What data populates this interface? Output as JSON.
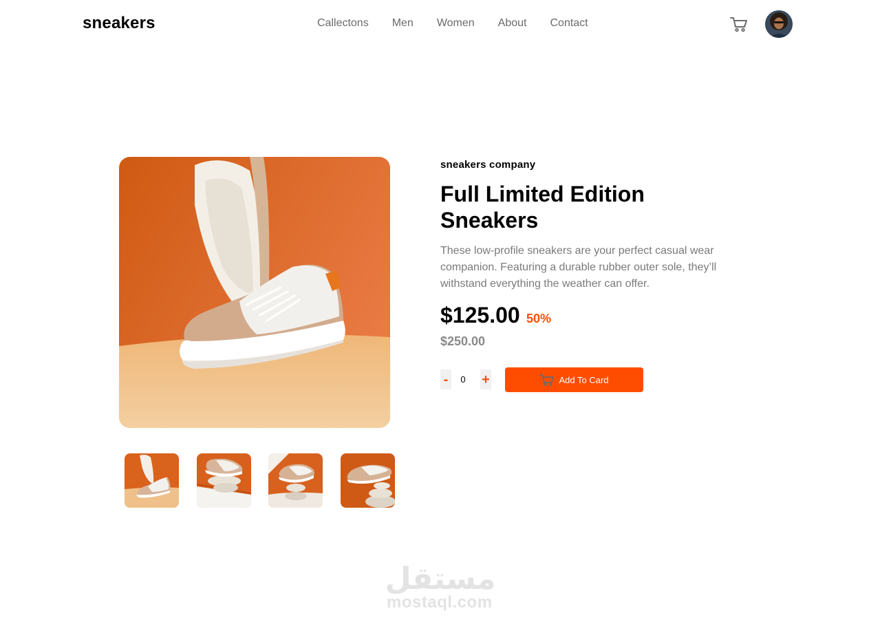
{
  "header": {
    "logo": "sneakers",
    "nav": [
      "Callectons",
      "Men",
      "Women",
      "About",
      "Contact"
    ],
    "cart_icon": "cart-icon",
    "avatar_icon": "user-avatar"
  },
  "product": {
    "company": "sneakers company",
    "title": "Full Limited Edition Sneakers",
    "description": "These low-profile sneakers are your perfect casual wear companion. Featuring a durable rubber outer sole, they’ll withstand everything the weather can offer.",
    "price": "$125.00",
    "discount": "50%",
    "old_price": "$250.00",
    "quantity": "0",
    "minus_label": "-",
    "plus_label": "+",
    "add_label": "Add To Card"
  },
  "colors": {
    "accent": "#ff4d00",
    "text_muted": "#7a7a7a",
    "photo_bg": "#e06a22",
    "floor": "#f0c48c"
  },
  "watermark": {
    "arabic": "مستقل",
    "latin": "mostaql.com"
  }
}
